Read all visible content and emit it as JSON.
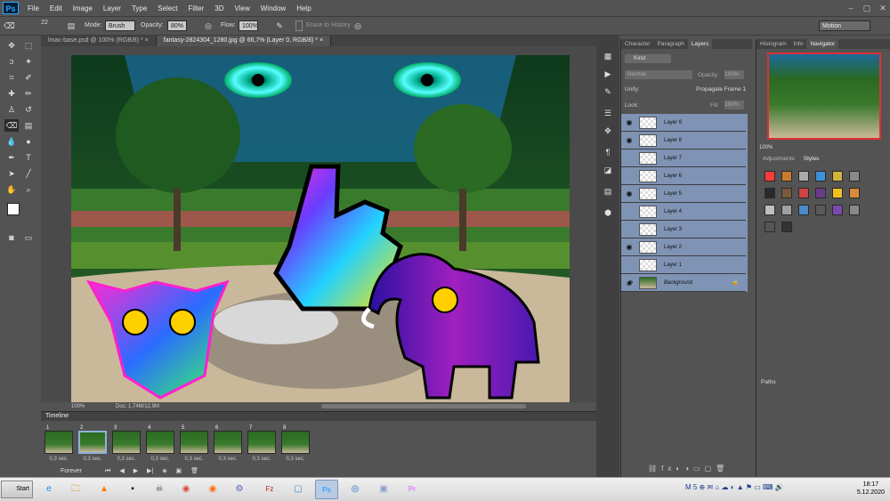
{
  "menubar": {
    "logo": "Ps",
    "items": [
      "File",
      "Edit",
      "Image",
      "Layer",
      "Type",
      "Select",
      "Filter",
      "3D",
      "View",
      "Window",
      "Help"
    ],
    "window_controls": [
      "–",
      "▢",
      "✕"
    ]
  },
  "options": {
    "brush_size": "22",
    "mode_label": "Mode:",
    "mode_value": "Brush",
    "opacity_label": "Opacity:",
    "opacity_value": "80%",
    "flow_label": "Flow:",
    "flow_value": "100%",
    "erase_history": "Erase to History",
    "workspace": "Motion"
  },
  "tabs": [
    {
      "label": "lmac-base.psd @ 100% (RGB/8) *",
      "close": "×"
    },
    {
      "label": "fantasy-2824304_1280.jpg @ 66,7% (Layer 0, RGB/8) *",
      "close": "×"
    }
  ],
  "status": {
    "zoom": "100%",
    "doc": "Doc: 1,74M/12,9M"
  },
  "timeline": {
    "title": "Timeline",
    "frames": [
      {
        "num": "1",
        "dur": "0,3 sec."
      },
      {
        "num": "2",
        "dur": "0,3 sec."
      },
      {
        "num": "3",
        "dur": "0,3 sec."
      },
      {
        "num": "4",
        "dur": "0,3 sec."
      },
      {
        "num": "5",
        "dur": "0,3 sec."
      },
      {
        "num": "6",
        "dur": "0,3 sec."
      },
      {
        "num": "7",
        "dur": "0,3 sec."
      },
      {
        "num": "8",
        "dur": "0,3 sec."
      }
    ],
    "loop": "Forever"
  },
  "layers_panel": {
    "tabs": [
      "Character",
      "Paragraph",
      "Layers"
    ],
    "kind": "Kind",
    "blend": "Normal",
    "opacity_label": "Opacity:",
    "opacity_value": "100%",
    "unify_label": "Unify:",
    "propagate": "Propagate Frame 1",
    "lock_label": "Lock:",
    "fill_label": "Fill:",
    "fill_value": "100%",
    "layers": [
      {
        "name": "Layer 9",
        "visible": true
      },
      {
        "name": "Layer 8",
        "visible": true
      },
      {
        "name": "Layer 7",
        "visible": false
      },
      {
        "name": "Layer 6",
        "visible": false
      },
      {
        "name": "Layer 5",
        "visible": true
      },
      {
        "name": "Layer 4",
        "visible": false
      },
      {
        "name": "Layer 3",
        "visible": false
      },
      {
        "name": "Layer 2",
        "visible": true
      },
      {
        "name": "Layer 1",
        "visible": false
      },
      {
        "name": "Background",
        "visible": true
      }
    ]
  },
  "navigator": {
    "tabs": [
      "Histogram",
      "Info",
      "Navigator"
    ],
    "zoom": "100%"
  },
  "styles": {
    "tabs": [
      "Adjustments",
      "Styles"
    ],
    "swatches": [
      "#ff3b3b",
      "#c87a2e",
      "#aaa",
      "#3f8fd6",
      "#d2b23c",
      "#8a8a8a",
      "#2a2a2a",
      "#7a5a3a",
      "#c44",
      "#6a3c8a",
      "#f0c020",
      "#d88a3a",
      "#c0c0c0",
      "#a0a0a0",
      "#4a8ac8",
      "#5a5a5a",
      "#7a4ab0",
      "#888",
      "#555",
      "#333"
    ]
  },
  "paths": {
    "title": "Paths"
  },
  "taskbar": {
    "start": "Start",
    "time": "18:17",
    "date": "5.12.2020",
    "apps": [
      "e",
      "🗀",
      "▲",
      "▪",
      "☠",
      "◉",
      "◉",
      "⚙",
      "Fz",
      "▢",
      "Ps",
      "◎",
      "▣",
      "Pr"
    ]
  }
}
